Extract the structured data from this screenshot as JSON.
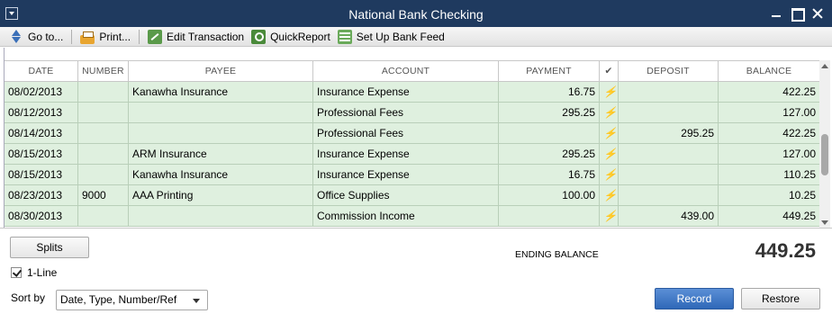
{
  "window": {
    "title": "National Bank Checking"
  },
  "toolbar": {
    "items": [
      {
        "label": "Go to...",
        "icon": "goto-icon"
      },
      {
        "label": "Print...",
        "icon": "print-icon"
      },
      {
        "label": "Edit Transaction",
        "icon": "edit-transaction-icon"
      },
      {
        "label": "QuickReport",
        "icon": "quickreport-icon"
      },
      {
        "label": "Set Up Bank Feed",
        "icon": "bank-feed-icon"
      }
    ]
  },
  "register": {
    "columns": [
      "DATE",
      "NUMBER",
      "PAYEE",
      "ACCOUNT",
      "PAYMENT",
      "✔",
      "DEPOSIT",
      "BALANCE"
    ],
    "rows": [
      {
        "date": "08/02/2013",
        "number": "",
        "payee": "Kanawha Insurance",
        "account": "Insurance Expense",
        "payment": "16.75",
        "cleared": "⚡",
        "deposit": "",
        "balance": "422.25"
      },
      {
        "date": "08/12/2013",
        "number": "",
        "payee": "",
        "account": "Professional Fees",
        "payment": "295.25",
        "cleared": "⚡",
        "deposit": "",
        "balance": "127.00"
      },
      {
        "date": "08/14/2013",
        "number": "",
        "payee": "",
        "account": "Professional Fees",
        "payment": "",
        "cleared": "⚡",
        "deposit": "295.25",
        "balance": "422.25"
      },
      {
        "date": "08/15/2013",
        "number": "",
        "payee": "ARM Insurance",
        "account": "Insurance Expense",
        "payment": "295.25",
        "cleared": "⚡",
        "deposit": "",
        "balance": "127.00"
      },
      {
        "date": "08/15/2013",
        "number": "",
        "payee": "Kanawha Insurance",
        "account": "Insurance Expense",
        "payment": "16.75",
        "cleared": "⚡",
        "deposit": "",
        "balance": "110.25"
      },
      {
        "date": "08/23/2013",
        "number": "9000",
        "payee": "AAA Printing",
        "account": "Office Supplies",
        "payment": "100.00",
        "cleared": "⚡",
        "deposit": "",
        "balance": "10.25"
      },
      {
        "date": "08/30/2013",
        "number": "",
        "payee": "",
        "account": "Commission Income",
        "payment": "",
        "cleared": "⚡",
        "deposit": "439.00",
        "balance": "449.25"
      }
    ],
    "row_color": "#dff0df"
  },
  "footer": {
    "splits_label": "Splits",
    "one_line_label": "1-Line",
    "one_line_checked": true,
    "sort_by_label": "Sort by",
    "sort_by_value": "Date, Type, Number/Ref",
    "ending_balance_label": "ENDING BALANCE",
    "ending_balance_value": "449.25",
    "record_label": "Record",
    "restore_label": "Restore"
  }
}
